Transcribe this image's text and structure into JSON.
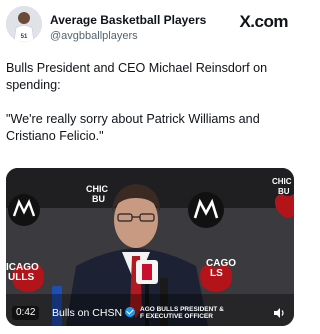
{
  "account": {
    "display_name": "Average Basketball Players",
    "handle": "@avgbballplayers",
    "avatar_icon": "avatar-icon"
  },
  "brand": "X.com",
  "tweet": {
    "line1": "Bulls President and CEO Michael Reinsdorf on spending:",
    "line2": "\"We're really sorry about Patrick Williams and Cristiano Felicio.\""
  },
  "video": {
    "time": "0:42",
    "channel": "Bulls on CHSN",
    "lower_third_line1": "AGO BULLS PRESIDENT &",
    "lower_third_line2": "F EXECUTIVE OFFICER",
    "backdrop_text": {
      "left_top": "CHIC",
      "left_top2": "BU",
      "left_bottom": "ICAGO",
      "left_bottom2": "ULLS",
      "right_top": "CHI",
      "right_top2": "BU",
      "right_mid": "CAGO",
      "right_mid2": "LS",
      "far_right": "CHIC",
      "far_right2": "BU"
    },
    "volume_icon": "volume-icon"
  }
}
